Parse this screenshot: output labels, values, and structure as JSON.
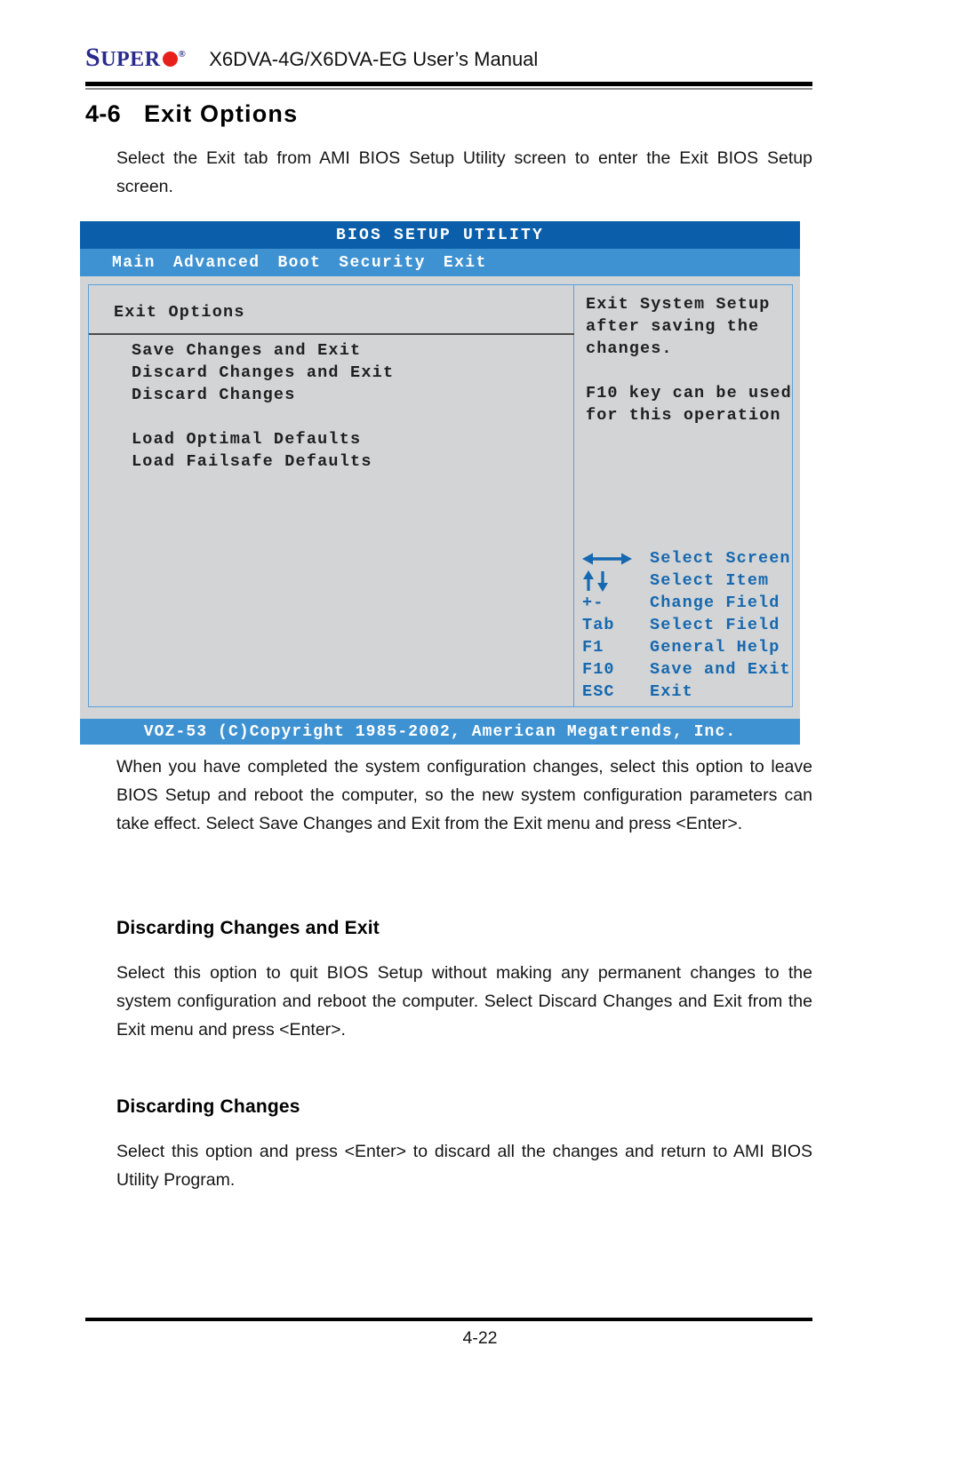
{
  "header": {
    "logo_super": "S",
    "logo_uper": "UPER",
    "logo_reg": "®",
    "title": "X6DVA-4G/X6DVA-EG User’s Manual"
  },
  "section": {
    "number": "4-6",
    "title": "Exit Options",
    "intro": "Select the Exit tab from AMI BIOS Setup Utility screen to enter the Exit BIOS Setup screen."
  },
  "bios": {
    "title": "BIOS SETUP UTILITY",
    "menu": [
      "Main",
      "Advanced",
      "Boot",
      "Security",
      "Exit"
    ],
    "panel_title": "Exit Options",
    "options": [
      "Save Changes and Exit",
      "Discard Changes and Exit",
      "Discard Changes",
      "Load Optimal Defaults",
      "Load Failsafe Defaults"
    ],
    "help_lines": [
      "Exit System Setup",
      "after saving the",
      "changes.",
      "F10 key can be used",
      "for this operation"
    ],
    "keys": [
      {
        "key": "↔",
        "desc": "Select Screen",
        "icon": "left-right-arrow-icon"
      },
      {
        "key": "↑↓",
        "desc": "Select Item",
        "icon": "up-down-arrow-icon"
      },
      {
        "key": "+-",
        "desc": "Change Field",
        "icon": "plus-minus-icon"
      },
      {
        "key": "Tab",
        "desc": "Select Field",
        "icon": "tab-key-icon"
      },
      {
        "key": "F1",
        "desc": "General Help",
        "icon": "f1-key-icon"
      },
      {
        "key": "F10",
        "desc": "Save and Exit",
        "icon": "f10-key-icon"
      },
      {
        "key": "ESC",
        "desc": "Exit",
        "icon": "esc-key-icon"
      }
    ],
    "copyright": "VOZ-53 (C)Copyright 1985-2002, American Megatrends, Inc.",
    "colors": {
      "title_bar": "#0b5faa",
      "menu_bar": "#3f92d2",
      "panel_bg": "#d2d4d5",
      "panel_border": "#5aa0de",
      "key_text": "#1668b0"
    }
  },
  "body": {
    "paragraph_1": "When you have completed the system configuration changes, select this option to leave BIOS Setup and reboot  the computer, so the new system configuration parameters can take effect. Select Save Changes and Exit from the Exit menu and press <Enter>.",
    "subhead_1": "Discarding Changes and Exit",
    "paragraph_2": "Select this option to quit BIOS Setup without making any permanent changes to the system configuration and reboot the computer. Select Discard Changes and Exit  from the Exit menu and press <Enter>.",
    "subhead_2": "Discarding Changes",
    "paragraph_3": "Select this option and press <Enter> to discard all the changes and return to AMI BIOS Utility Program."
  },
  "footer": {
    "page_number": "4-22"
  }
}
